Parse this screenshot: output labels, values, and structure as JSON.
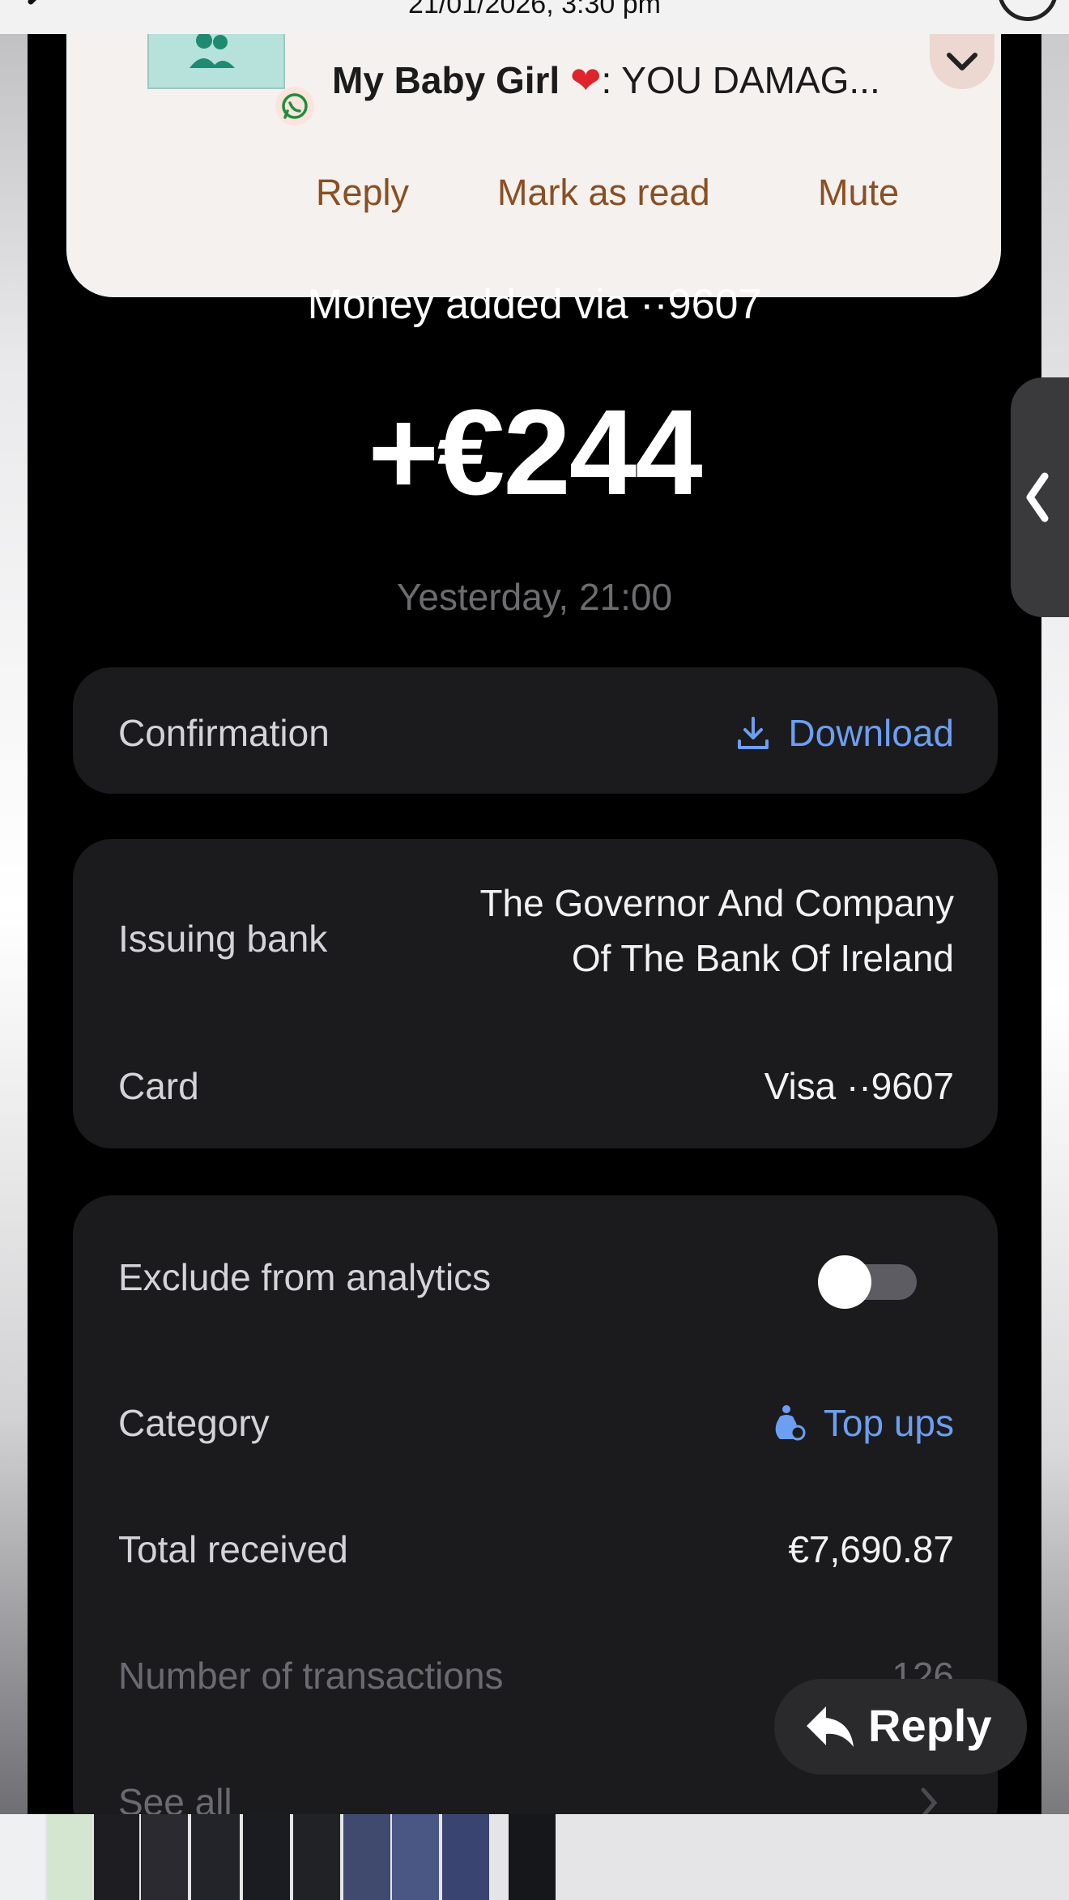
{
  "status": {
    "datetime": "21/01/2026, 3:30 pm"
  },
  "notification": {
    "sender": "My Baby Girl",
    "preview": ": YOU DAMAG...",
    "actions": [
      "Reply",
      "Mark as read",
      "Mute"
    ]
  },
  "transaction": {
    "title": "Money added via ··9607",
    "amount": "+€244",
    "date": "Yesterday, 21:00"
  },
  "confirmation": {
    "label": "Confirmation",
    "action": "Download"
  },
  "details": {
    "issuing_bank_label": "Issuing bank",
    "issuing_bank_line1": "The Governor And Company",
    "issuing_bank_line2": "Of The Bank Of Ireland",
    "card_label": "Card",
    "card_value": "Visa ··9607"
  },
  "analytics": {
    "exclude_label": "Exclude from analytics",
    "exclude_enabled": false,
    "category_label": "Category",
    "category_value": "Top ups",
    "total_label": "Total received",
    "total_value": "€7,690.87",
    "count_label": "Number of transactions",
    "count_value": "126",
    "see_all_label": "See all"
  },
  "floating_reply": {
    "label": "Reply"
  },
  "colors": {
    "accent_link": "#6d9ff1",
    "notification_action": "#8a4f22",
    "screen_bg": "#000000",
    "card_bg": "#1b1b1e"
  }
}
